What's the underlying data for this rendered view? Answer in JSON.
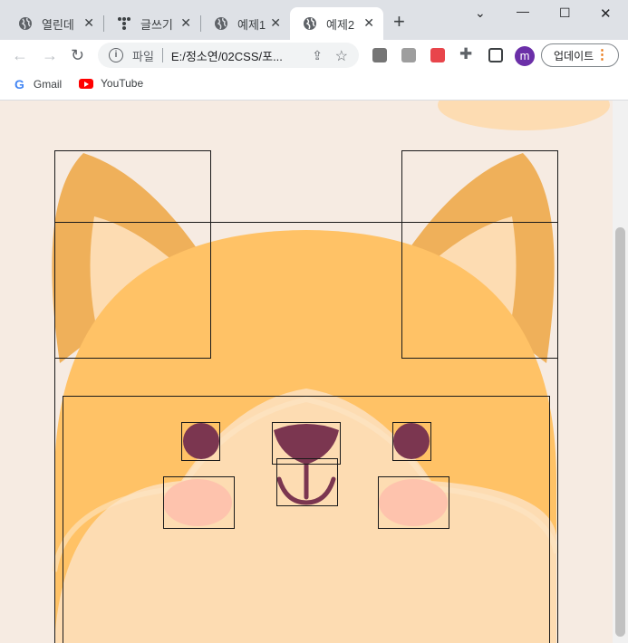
{
  "tabs": [
    {
      "label": "열린데",
      "icon": "globe-icon"
    },
    {
      "label": "글쓰기",
      "icon": "tistory-icon"
    },
    {
      "label": "예제1",
      "icon": "globe-icon"
    },
    {
      "label": "예제2",
      "icon": "globe-icon",
      "active": true
    }
  ],
  "toolbar": {
    "scheme": "파일",
    "url": "E:/정소연/02CSS/포...",
    "avatar_letter": "m",
    "update_label": "업데이트"
  },
  "bookmarks": [
    {
      "label": "Gmail",
      "icon": "google-icon"
    },
    {
      "label": "YouTube",
      "icon": "youtube-icon"
    }
  ],
  "colors": {
    "page_bg": "#f6ebe2",
    "fur": "#ffc266",
    "ear_outer": "#efb05a",
    "ear_inner": "#fddcb2",
    "muzzle": "#fddcb2",
    "eyes_nose": "#7b3650",
    "blush": "#fec3ad"
  }
}
